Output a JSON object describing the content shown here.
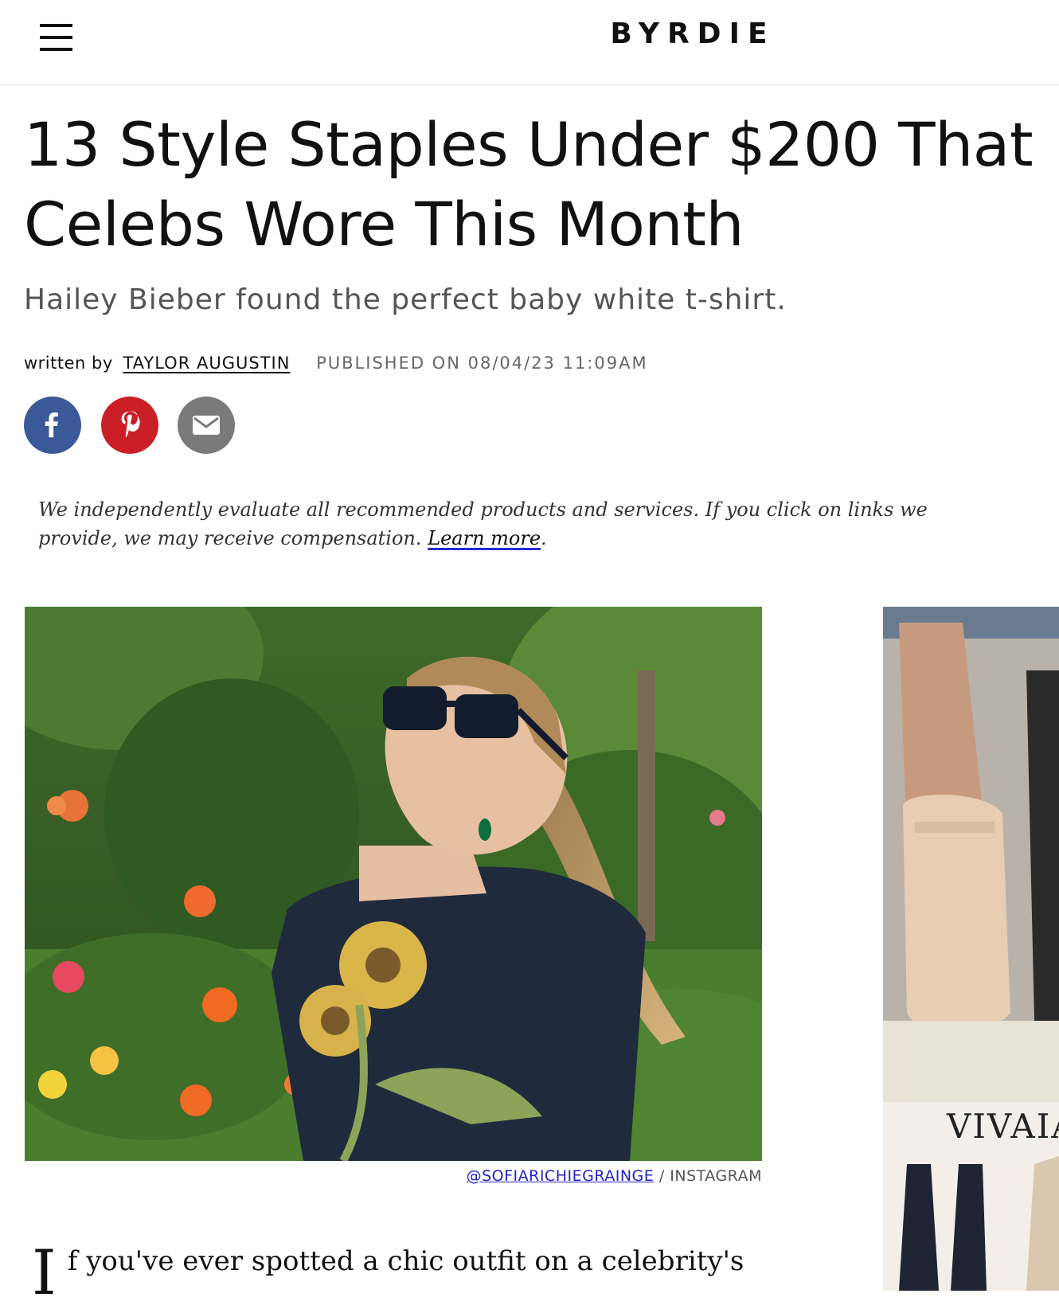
{
  "header": {
    "menu_icon": "hamburger-menu-icon",
    "logo": "BYRDIE"
  },
  "article": {
    "title_line1": "13 Style Staples Under $200 That",
    "title_line2": "Celebs Wore This Month",
    "subtitle": "Hailey Bieber found the perfect baby white t-shirt.",
    "byline_prefix": "written by",
    "author": "TAYLOR AUGUSTIN",
    "published": "PUBLISHED ON 08/04/23 11:09AM",
    "share": [
      {
        "icon": "facebook-icon",
        "color": "#3b5998"
      },
      {
        "icon": "pinterest-icon",
        "color": "#cb1f27"
      },
      {
        "icon": "email-icon",
        "color": "#7a7a7a"
      }
    ],
    "disclaimer_text": "We independently evaluate all recommended products and services. If you click on links we provide, we may receive compensation. ",
    "disclaimer_link": "Learn more",
    "disclaimer_end": ".",
    "image_caption_handle": "@SOFIARICHIEGRAINGE",
    "image_caption_source": " / INSTAGRAM",
    "body_dropcap": "I",
    "body_start": "f you've ever spotted a chic outfit on a celebrity's"
  },
  "ad": {
    "brand": "VIVAIA"
  }
}
